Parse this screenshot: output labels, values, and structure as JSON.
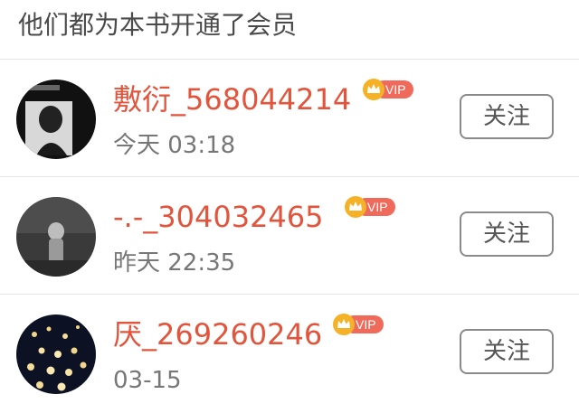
{
  "header": {
    "title": "他们都为本书开通了会员"
  },
  "members": [
    {
      "name": "敷衍_568044214",
      "badge": "VIP",
      "time": "今天 03:18",
      "follow_label": "关注"
    },
    {
      "name": "-.-_304032465",
      "badge": "VIP",
      "time": "昨天 22:35",
      "follow_label": "关注"
    },
    {
      "name": "厌_269260246",
      "badge": "VIP",
      "time": "03-15",
      "follow_label": "关注"
    }
  ],
  "icons": {
    "badge": "vip-crown-icon"
  },
  "colors": {
    "name": "#e2543b",
    "vip_badge": "#ef6a5a",
    "crown": "#f5b227",
    "time": "#777777",
    "divider": "#e6e6e6"
  }
}
